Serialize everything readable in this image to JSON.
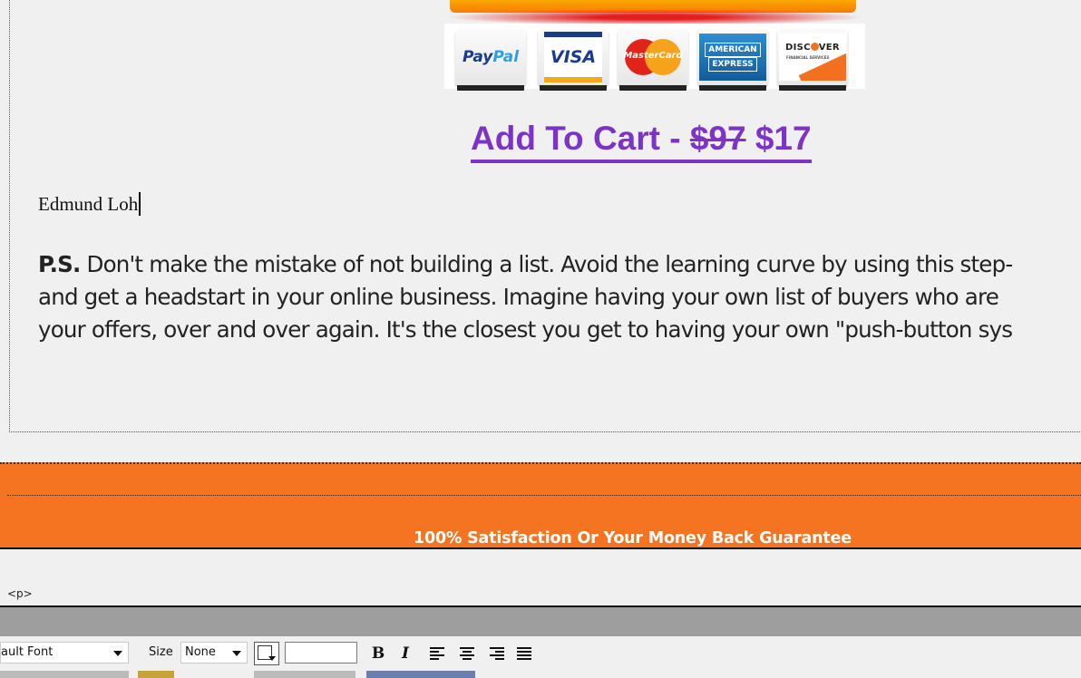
{
  "payment_cards": {
    "paypal": {
      "pay": "Pay",
      "pal": "Pal"
    },
    "visa": "VISA",
    "mastercard": "MasterCard",
    "amex": {
      "line1": "AMERICAN",
      "line2": "EXPRESS"
    },
    "discover": {
      "left": "DISC",
      "right": "VER",
      "sub": "FINANCIAL SERVICES"
    }
  },
  "cart_link": {
    "prefix": "Add To Cart - ",
    "old_price": "$97",
    "new_price": "$17"
  },
  "signature": "Edmund Loh",
  "ps": {
    "bold_label": "P.S.",
    "line1": " Don't make the mistake of not building a list. Avoid the learning curve by using this step-",
    "line2": "and get a headstart in your online business. Imagine having your own list of buyers who are",
    "line3": "your offers, over and over again. It's the closest you get to having your own \"push-button sys"
  },
  "guarantee_text": "100% Satisfaction Or Your Money Back Guarantee",
  "tag_path": "<p>",
  "toolbar": {
    "font_value": "ault Font",
    "size_label": "Size",
    "size_value": "None",
    "color_value": "",
    "bold": "B",
    "italic": "I"
  },
  "colors": {
    "link_purple": "#7e33c7",
    "orange": "#f47421",
    "gray_bar": "#9e9e9e",
    "background": "#f0f0f0"
  }
}
